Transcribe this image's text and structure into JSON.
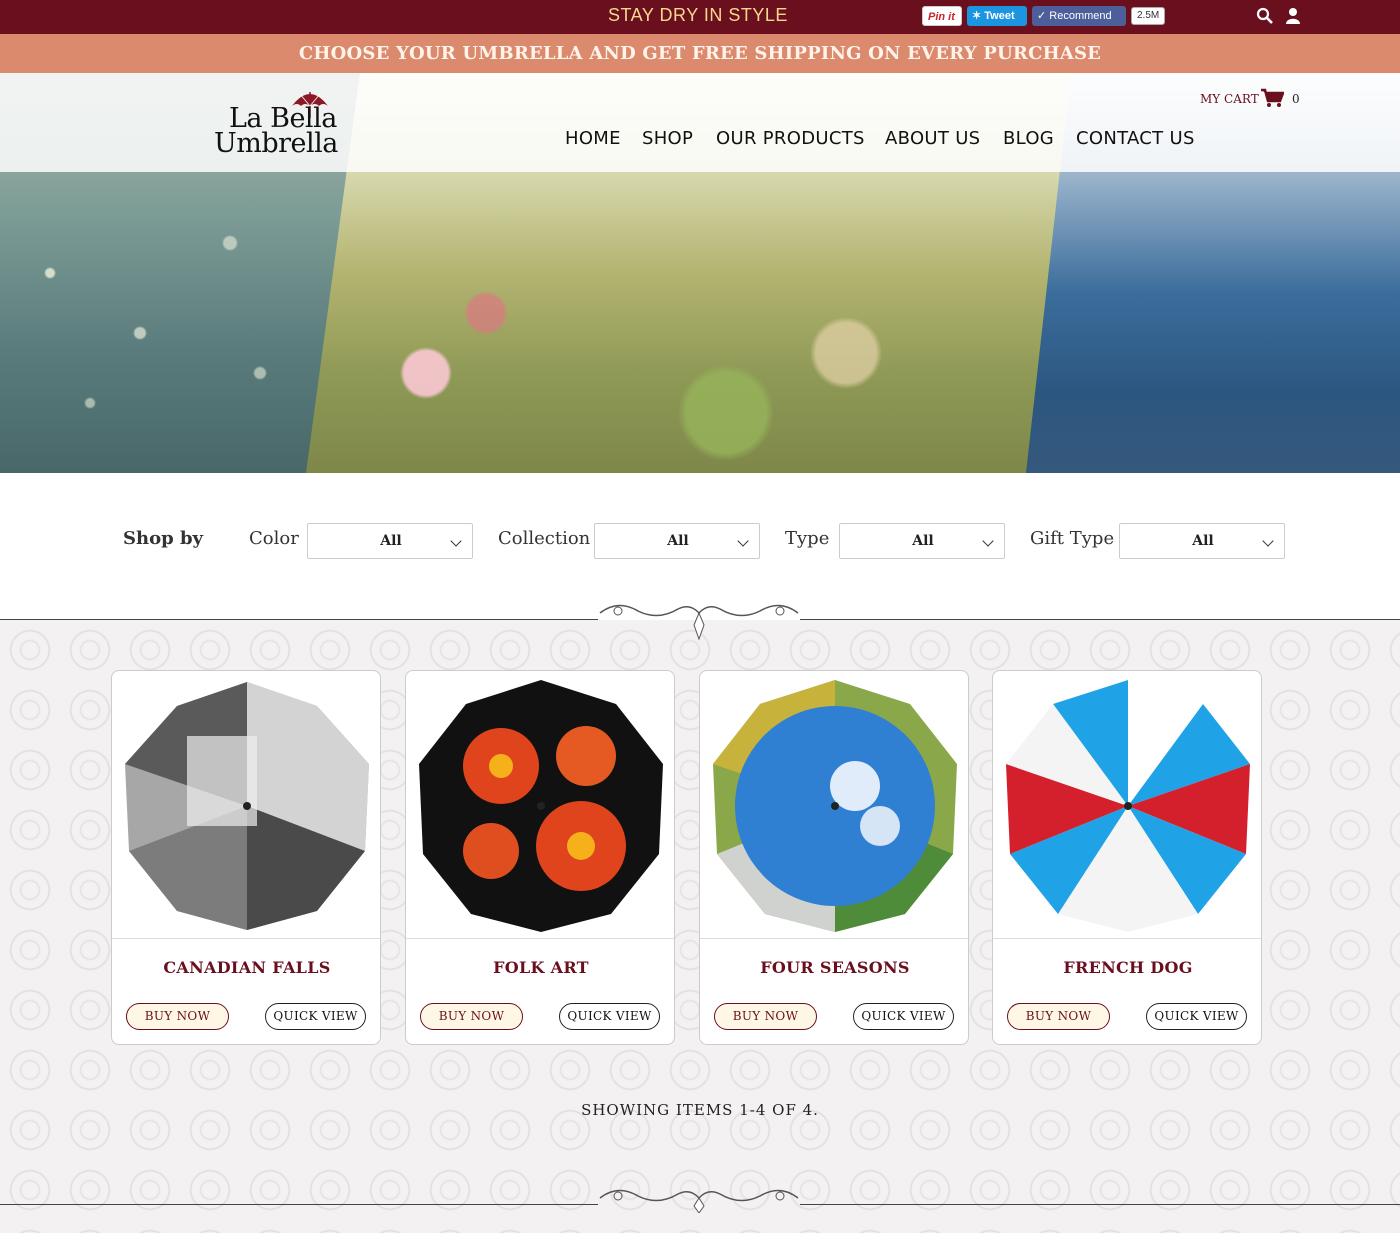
{
  "topbar": {
    "slogan": "STAY DRY IN STYLE",
    "social": {
      "pin_label": "Pin it",
      "tweet_label": "Tweet",
      "recommend_label": "Recommend",
      "recommend_count": "2.5M"
    },
    "icons": [
      "search-icon",
      "user-icon"
    ]
  },
  "promo": {
    "text": "CHOOSE YOUR UMBRELLA AND GET FREE SHIPPING ON EVERY PURCHASE"
  },
  "brand": {
    "line1": "La Bella",
    "line2": "Umbrella"
  },
  "cart": {
    "label": "MY CART",
    "count": "0"
  },
  "nav": {
    "items": [
      "HOME",
      "SHOP",
      "OUR PRODUCTS",
      "ABOUT US",
      "BLOG",
      "CONTACT US"
    ]
  },
  "filters": {
    "title": "Shop by",
    "groups": [
      {
        "label": "Color",
        "value": "All"
      },
      {
        "label": "Collection",
        "value": "All"
      },
      {
        "label": "Type",
        "value": "All"
      },
      {
        "label": "Gift Type",
        "value": "All"
      }
    ]
  },
  "products": [
    {
      "name": "CANADIAN FALLS",
      "buy": "BUY NOW",
      "quick": "QUICK VIEW"
    },
    {
      "name": "FOLK ART",
      "buy": "BUY NOW",
      "quick": "QUICK VIEW"
    },
    {
      "name": "FOUR SEASONS",
      "buy": "BUY NOW",
      "quick": "QUICK VIEW"
    },
    {
      "name": "FRENCH DOG",
      "buy": "BUY NOW",
      "quick": "QUICK VIEW"
    }
  ],
  "pagination": {
    "showing": "SHOWING ITEMS 1-4 OF 4."
  },
  "colors": {
    "brand": "#6a0f1e",
    "promo": "#dc8a6e",
    "slogan": "#f7d98d"
  }
}
